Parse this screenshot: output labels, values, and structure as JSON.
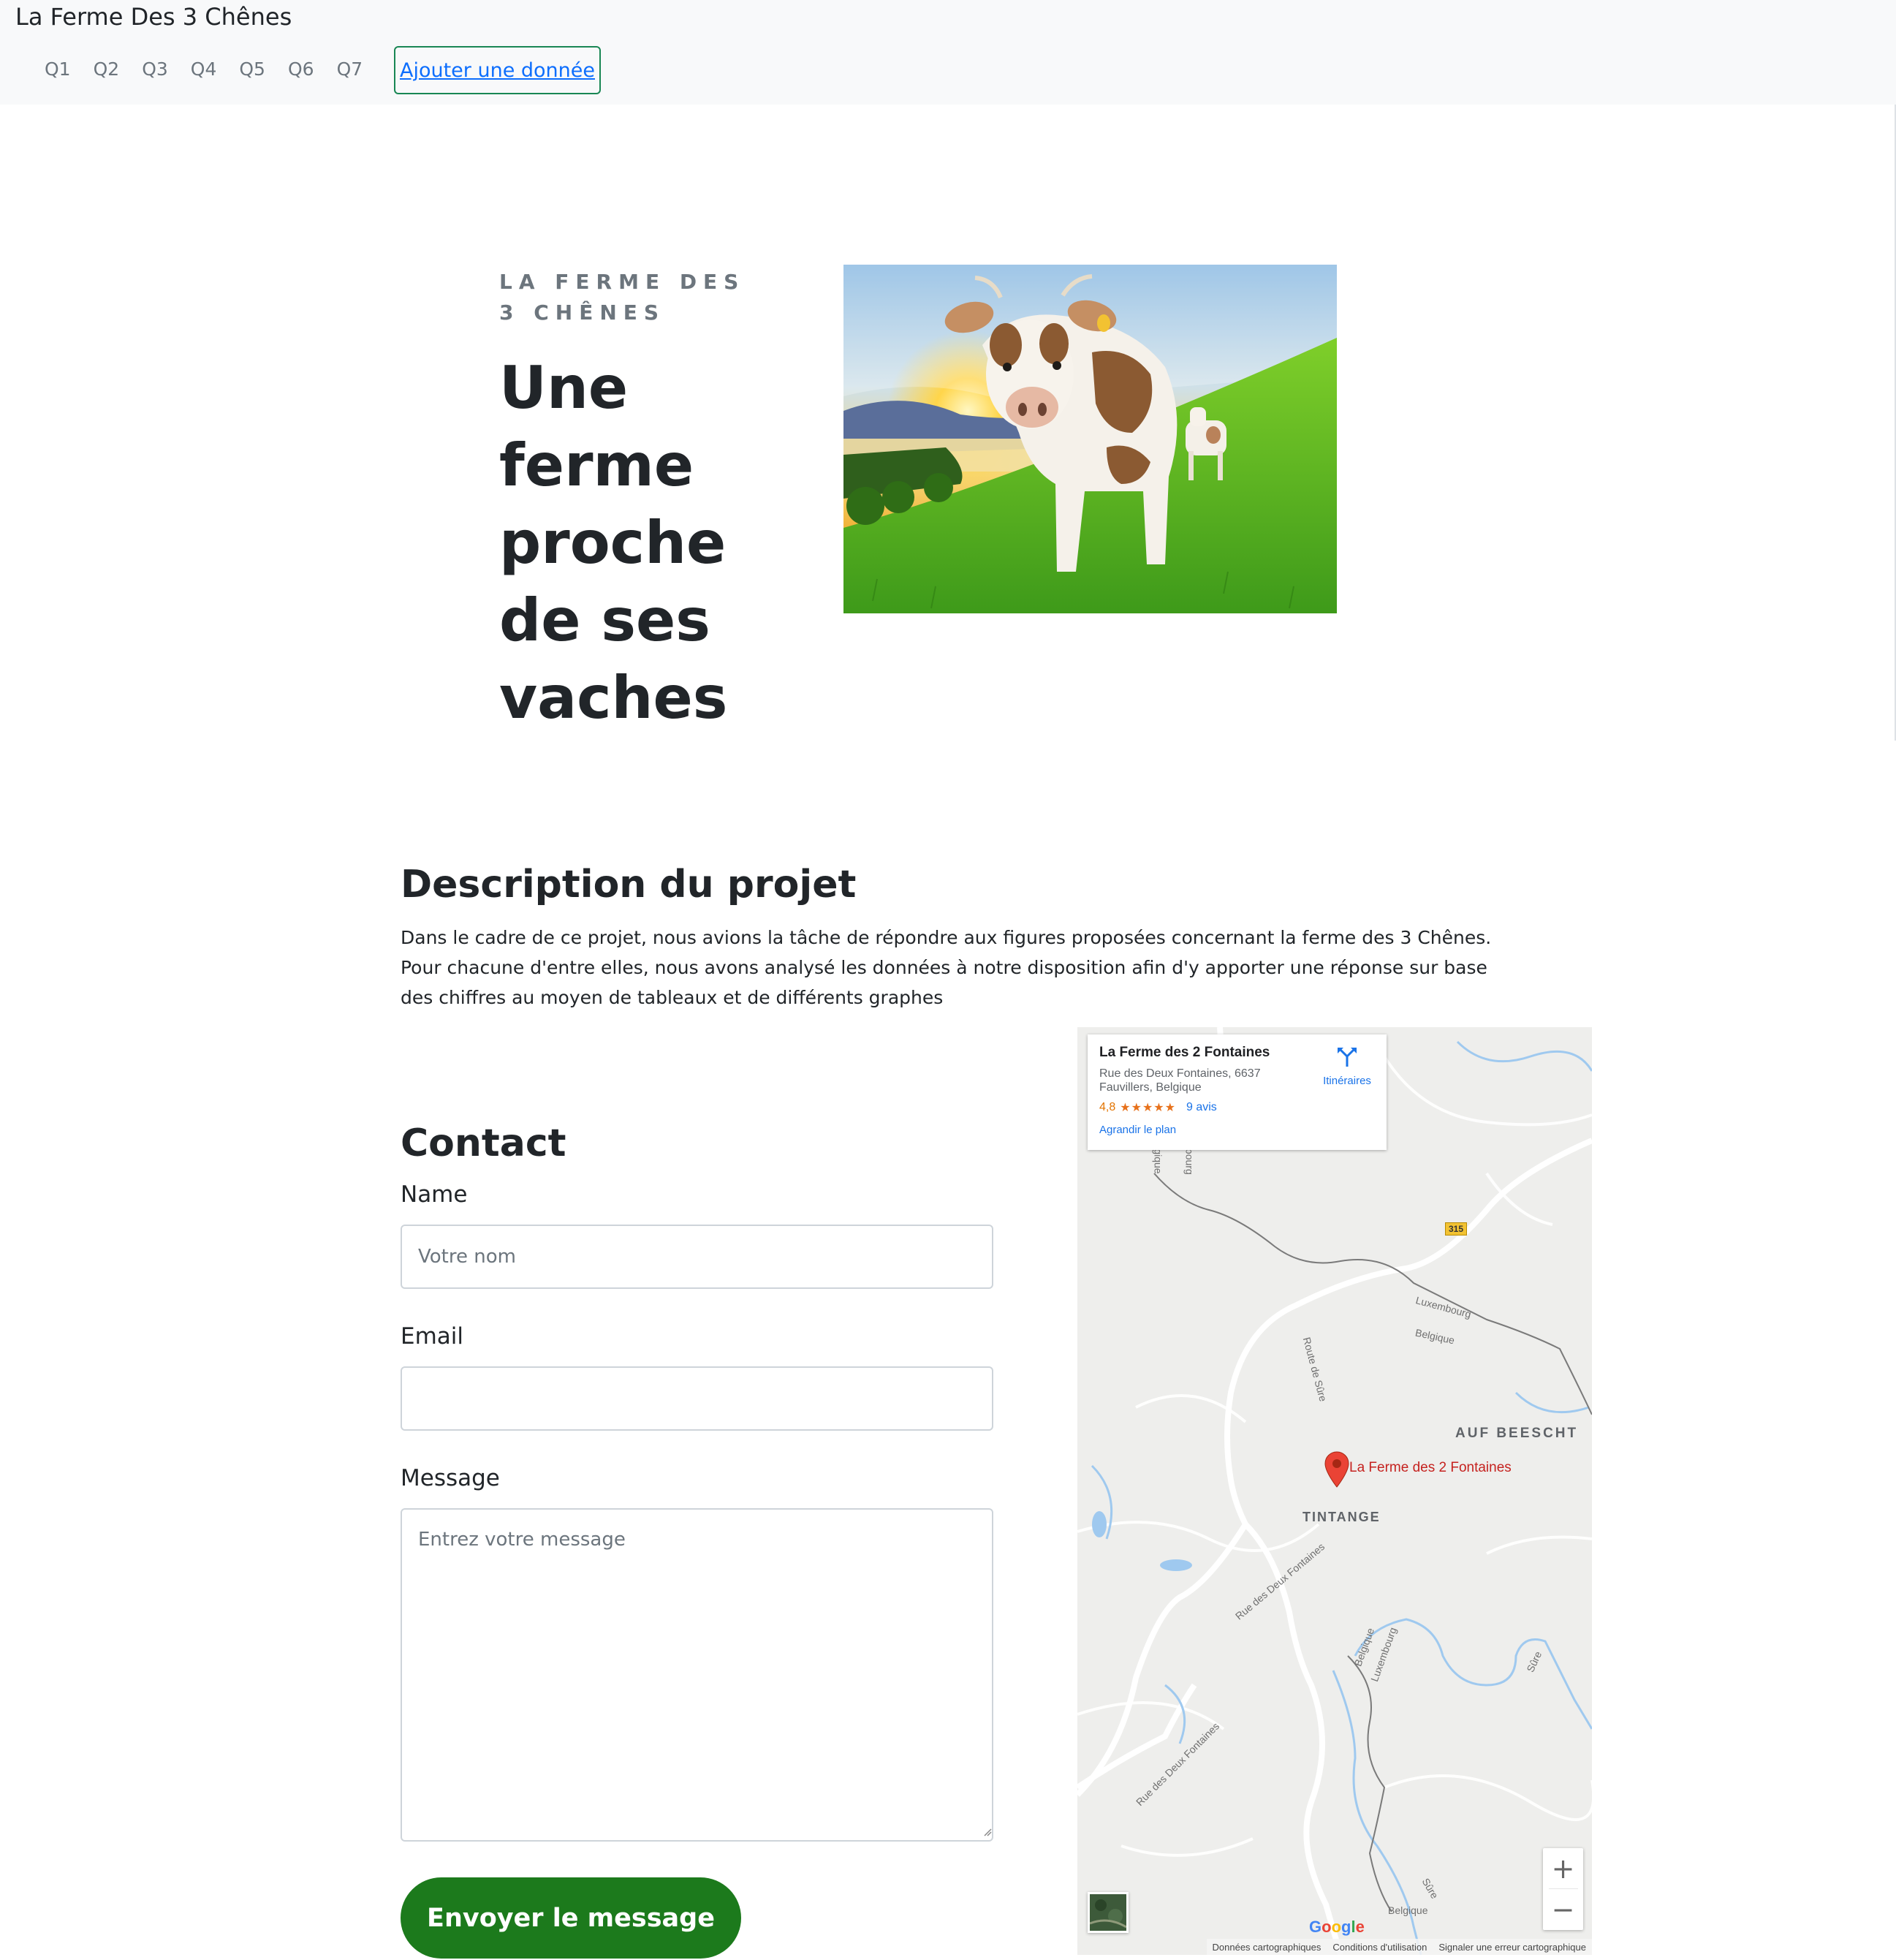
{
  "navbar": {
    "brand": "La Ferme Des 3 Chênes",
    "links": [
      "Q1",
      "Q2",
      "Q3",
      "Q4",
      "Q5",
      "Q6",
      "Q7"
    ],
    "add_button": "Ajouter une donnée"
  },
  "hero": {
    "eyebrow": "LA FERME DES 3 CHÊNES",
    "title": "Une ferme proche de ses vaches"
  },
  "description": {
    "heading": "Description du projet",
    "text": "Dans le cadre de ce projet, nous avions la tâche de répondre aux figures proposées concernant la ferme des 3 Chênes. Pour chacune d'entre elles, nous avons analysé les données à notre disposition afin d'y apporter une réponse sur base des chiffres au moyen de tableaux et de différents graphes"
  },
  "contact": {
    "heading": "Contact",
    "name_label": "Name",
    "name_placeholder": "Votre nom",
    "email_label": "Email",
    "email_placeholder": "",
    "message_label": "Message",
    "message_placeholder": "Entrez votre message",
    "submit_label": "Envoyer le message"
  },
  "map": {
    "card_title": "La Ferme des 2 Fontaines",
    "card_address": "Rue des Deux Fontaines, 6637 Fauvillers, Belgique",
    "rating": "4,8",
    "stars": "★★★★★",
    "reviews": "9 avis",
    "enlarge": "Agrandir le plan",
    "directions": "Itinéraires",
    "region": "AUF BEESCHT",
    "village": "TINTANGE",
    "pin_label": "La Ferme des 2 Fontaines",
    "road_number": "315",
    "road_labels": {
      "luxembourg_1": "Luxembourg",
      "belgique_1": "Belgique",
      "route_sure": "Route de Sûre",
      "rue_deux_fontaines_1": "Rue des Deux Fontaines",
      "rue_deux_fontaines_2": "Rue des Deux Fontaines",
      "belgique_2": "Belgique",
      "luxembourg_2": "Luxembourg",
      "sure_1": "Sûre",
      "sure_2": "Sûre",
      "belgique_3": "Belgique",
      "belgique_top": "elgique",
      "luxembourg_top": "mbourg"
    },
    "zoom_in": "+",
    "zoom_out": "−",
    "google": [
      "G",
      "o",
      "o",
      "g",
      "l",
      "e"
    ],
    "footer": [
      "Données cartographiques",
      "Conditions d'utilisation",
      "Signaler une erreur cartographique"
    ],
    "colors": {
      "land": "#eeeeec",
      "road": "#ffffff",
      "water": "#9fc9ef",
      "border": "#7a7a7a",
      "pin": "#ea4335"
    }
  },
  "colors": {
    "accent_green": "#1c7a1c",
    "outline_green": "#198754",
    "link_blue": "#0d6efd",
    "muted": "#6c757d"
  }
}
